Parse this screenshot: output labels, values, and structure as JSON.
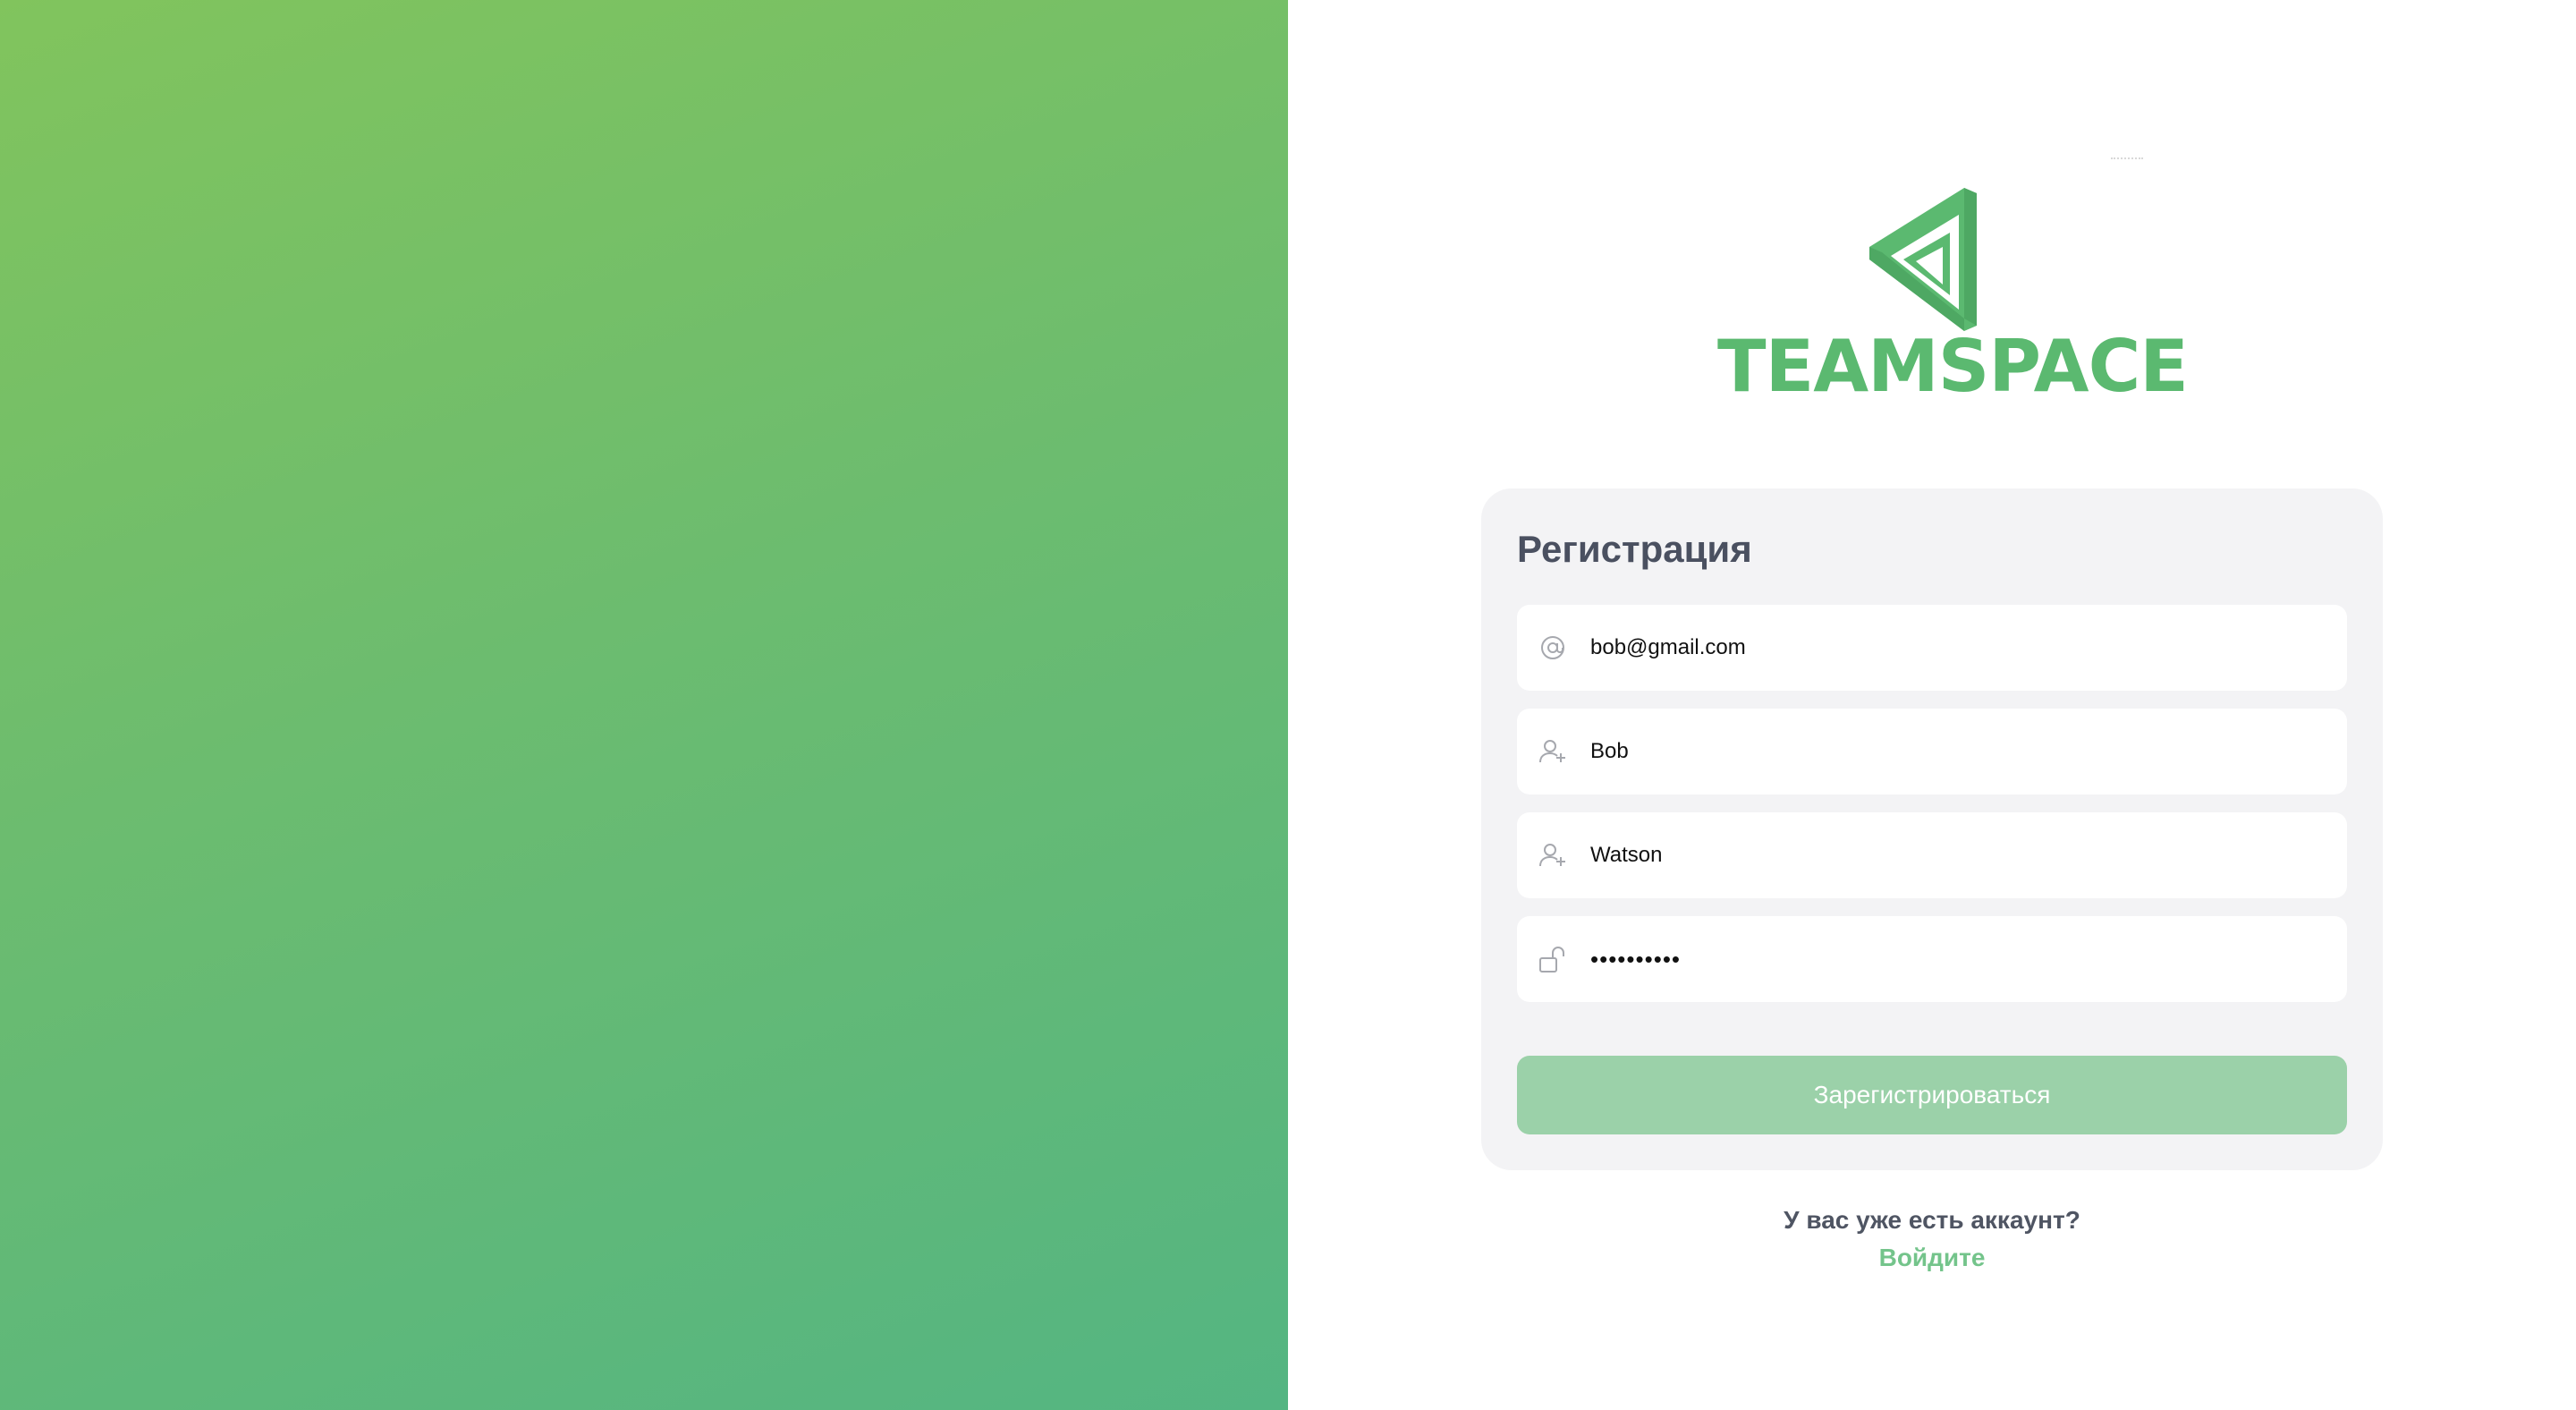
{
  "brand": {
    "name": "TEAMSPACE",
    "color": "#5bb970",
    "logo_icon": "impossible-triangle-logo-icon"
  },
  "colors": {
    "gradient_start": "#81c45d",
    "gradient_end": "#54b582",
    "button_bg": "#9bd1a9",
    "link": "#74c48b",
    "card_bg": "#f3f3f5"
  },
  "form": {
    "title": "Регистрация",
    "fields": [
      {
        "icon": "at-sign-icon",
        "value": "bob@gmail.com"
      },
      {
        "icon": "user-plus-icon",
        "value": "Bob"
      },
      {
        "icon": "user-plus-icon",
        "value": "Watson"
      },
      {
        "icon": "unlock-icon",
        "value": "••••••••••"
      }
    ],
    "submit_label": "Зарегистрироваться"
  },
  "footer": {
    "question": "У вас уже есть аккаунт?",
    "link_label": "Войдите"
  }
}
